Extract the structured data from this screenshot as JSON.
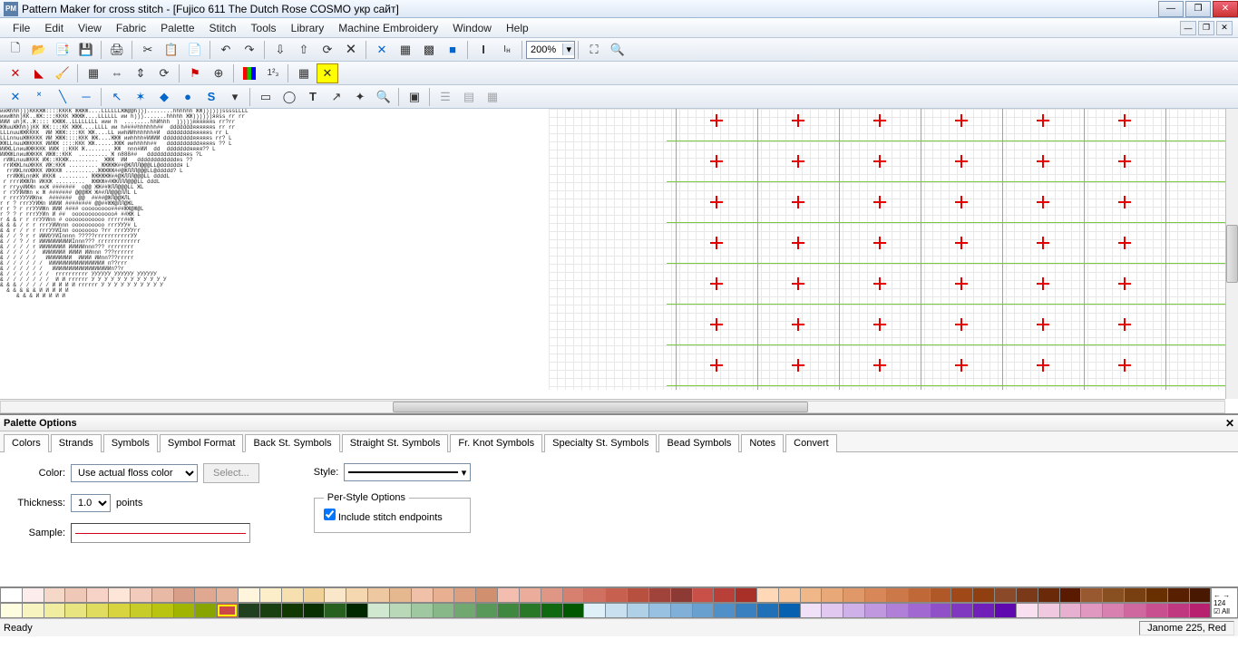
{
  "title": "Pattern Maker for cross stitch - [Fujico 611 The Dutch Rose COSMO укр сайт]",
  "menus": [
    "File",
    "Edit",
    "View",
    "Fabric",
    "Palette",
    "Stitch",
    "Tools",
    "Library",
    "Machine Embroidery",
    "Window",
    "Help"
  ],
  "zoom": "200%",
  "palette_options": {
    "title": "Palette Options",
    "tabs": [
      "Colors",
      "Strands",
      "Symbols",
      "Symbol Format",
      "Back St. Symbols",
      "Straight St. Symbols",
      "Fr. Knot Symbols",
      "Specialty St. Symbols",
      "Bead Symbols",
      "Notes",
      "Convert"
    ],
    "active_tab": 4,
    "labels": {
      "color": "Color:",
      "thickness": "Thickness:",
      "sample": "Sample:",
      "style": "Style:",
      "select": "Select...",
      "points": "points",
      "perstyle": "Per-Style Options",
      "include": "Include stitch endpoints"
    },
    "values": {
      "color": "Use actual floss color",
      "thickness": "1.0"
    }
  },
  "colors_row1": [
    "#ffffff",
    "#fdecec",
    "#f5d8c8",
    "#f0c8b8",
    "#f7d2c6",
    "#fde5d8",
    "#f2cbbd",
    "#e8baa6",
    "#d89e88",
    "#e0a890",
    "#e6b49a",
    "#fff4dc",
    "#fceec8",
    "#f6e0b0",
    "#f0d298",
    "#fae6c8",
    "#f5d8b0",
    "#eec8a0",
    "#e6b890",
    "#f0c0a8",
    "#e8b090",
    "#dca080",
    "#d09070",
    "#f3bdb0",
    "#ecac9c",
    "#e09684",
    "#d88070",
    "#d07060",
    "#c86050",
    "#b85040",
    "#9f433b",
    "#8e3a34",
    "#c85048",
    "#b84038",
    "#a83028",
    "#ffd8b8",
    "#f8c8a0",
    "#f0b888",
    "#e8a878",
    "#e09868",
    "#d88858",
    "#cc7848",
    "#c06838",
    "#b05828",
    "#a04818",
    "#904010",
    "#8a4a2a",
    "#7a3a1a",
    "#6a2a0a",
    "#5a1a00",
    "#985830",
    "#885020",
    "#784010",
    "#683000",
    "#582000",
    "#481800"
  ],
  "colors_row2": [
    "#fffde0",
    "#f8f4c0",
    "#f0eca0",
    "#e8e480",
    "#e0dc60",
    "#d8d440",
    "#c8cc28",
    "#b8c410",
    "#a0b400",
    "#88a400",
    "#cc4848",
    "#204020",
    "#184010",
    "#103800",
    "#083000",
    "#286020",
    "#002800",
    "#d0e8d0",
    "#b8d8b8",
    "#a0c8a0",
    "#88b888",
    "#70a870",
    "#589858",
    "#408840",
    "#287828",
    "#106810",
    "#005800",
    "#e0f0f8",
    "#c8e0f0",
    "#b0d0e8",
    "#98c0e0",
    "#80b0d8",
    "#68a0d0",
    "#5090c8",
    "#3880c0",
    "#2070b8",
    "#0860b0",
    "#f0e0f8",
    "#e0c8f0",
    "#d0b0e8",
    "#c098e0",
    "#b080d8",
    "#a068d0",
    "#9050c8",
    "#8038c0",
    "#7020b8",
    "#6008b0",
    "#f8e0f0",
    "#f0c8e0",
    "#e8b0d0",
    "#e098c0",
    "#d880b0",
    "#d068a0",
    "#c85090",
    "#c03880",
    "#b82070"
  ],
  "endpanel": {
    "count": "124",
    "all": "All"
  },
  "status": {
    "left": "Ready",
    "right": "Janome  225, Red"
  },
  "pattern_sample": "ииЖhhh)))КККЖЖ::::КККК ЖЖЖЖ....LLLLLLЖЖ@@h)))........hhhhhh ЖЖ))))))ssssLLLL\nиииЖhh)КК..ЖЖ::::КККК ЖЖЖЖ....LLLLLL ии h))).......hhhhh ЖЖ))))))яяss rr rr\nИИИ uh)К..Ж:::: КЖЖЖ..LLLLLLLL иии h  ........hhИhhh  )))))яяяяяяs rr?rr\nЖЖuuЖЖhh))КК ЖЖ::::КК ЖЖЖ....LLLL ии h####hhhhhh##  dddddddяяяяяяs rr rr\nLLLnuuЖЖКККК  ИИ ЖЖЖ::::КК ЖЖ....LL ииhИИhhhhhh#И  ddddddddяяяяяs rr L\nLLLnnuuЖЖКККК ИИ ЖЖЖ::::ККК ЖЖ....ЖЖЖ ииhhhh#ИИИИ dddddddddяяяяяs rr? L\nЖЖLLnuuЖЖКККК ИИЖЖ ::::ККК ЖЖ......ЖЖЖ ииhhhhh##   ddddddddddяяяяs ?? L\nИИЖLLnиuЖЖКККК ИИЖ ::ККК Ж........ ЖЖ  nnn#ИИ  dd  dddddddяяяя?? L\nИИЖЖLnиuЖЖККК ИЖЖ::ККК  ......... Ж n888##   dddddddddddяяs ?L\n rИЖLnuuЖККК ИЖ::ККЖЖ.........  ЖЖЖ  ИИ   ddddddddddddяs ??\n rrИЖЖLnuЖККК ИЖ:ККЖ ......... ЖЖЖЖЖ##@ЖЛЛЛ@@@LL@ddddddя L\n  rrИЖLnnЖЖКК ИЖККЖ ..........ЖЖЖЖЖ##@ЖЛЛЛ@@@LL@ddddd? L\n  rrИЖЖLnnЖК ИККЖ ......... ЖЖЖЖЖЖ##@ЖЛЛЛ@@@LL ddddL\n r rrrИЖЖЛn ИККЖ .........  ЖЖЖЖ##ЖЖЛЛЛ@@@LL dddL\n r rrууИИЖn ккЖ #######  o@@ ЖЖ##ЖЛЛ@@@LL ЖL\n r rУУИИЖn к Ж ####### @@@ЖЖ Ж##ЛЛ@@@ЛЛL L\n r rrrУУУИЖnк  #######  @@  ####@ЖЛ@@ЖЛL\nr r ? rrrУУИЖn ИИИИ ######## @@##ЖЖ@ЛЛ@ЖL\nr r ? r rrУУИЖn ИИИ #### ooooooooo####ЖЖ@Ж@L\nr ? ? r rrrУУИn И ##  ooooooooooooo# ##ЖЖ L\nr & & r r rrУУИnn # oooooooooooo rrrrr##Ж\n& & & / r r rrrУИИnnn oooooooooo rrrУУУ# L\n& & r / r r rrrУУИInn oooooooo ?rr rrrУУУrr\n& / / ? r r ИИИУУИInnnn ?????rrrrrrrrrrrУУ\n& / / ? / r ИИИИИИИИИИInnn??? rrrrrrrrrrrrr\n& / / / / r ИИИИИИИИ ИИИИИnnn??? rrrrrrrr\n& / / / / /  ИИИИИИИ ИИИИ ИИnnn ???rrrrrr\n& / / / / /   ИИИИИИИИ  ИИИИ ИИnn???rrrrr\n& / / / / / /  ИИИИИИИИИИИИИИИИИ n??rrr\n& / / / / / /   ИИИИИИИИИИИИИИИИИИn??r\n& / / / / / / /  rrrrrrrrrr УУУУУУ УУУУУУ УУУУУУ\n& / / / / / / /  И И rrrrrr У У У У У У У У У У У У\n& & & / / / / / И И И И rrrrrr У У У У У У У У У У\n  & & & & & И И И И И\n     & & & И И И И И"
}
